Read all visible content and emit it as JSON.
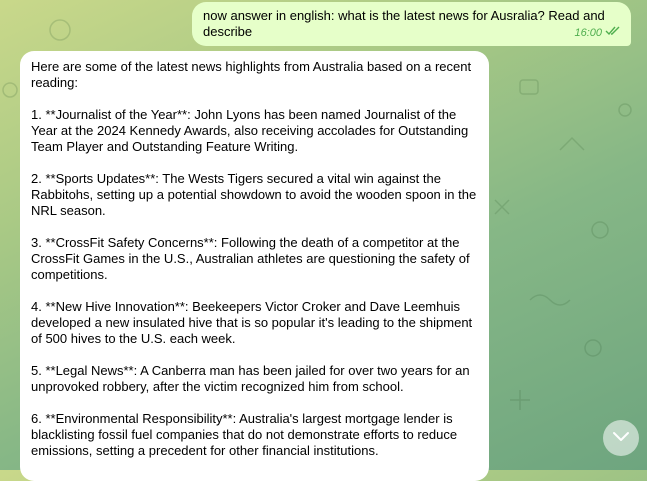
{
  "chat": {
    "outgoing": {
      "text": "now answer in english: what is the latest news for Ausralia? Read and describe",
      "time": "16:00",
      "status_icon": "double-check-icon"
    },
    "incoming": {
      "paragraphs": [
        "Here are some of the latest news highlights from Australia based on a recent reading:",
        "1. **Journalist of the Year**: John Lyons has been named Journalist of the Year at the 2024 Kennedy Awards, also receiving accolades for Outstanding Team Player and Outstanding Feature Writing.",
        "2. **Sports Updates**: The Wests Tigers secured a vital win against the Rabbitohs, setting up a potential showdown to avoid the wooden spoon in the NRL season.",
        "3. **CrossFit Safety Concerns**: Following the death of a competitor at the CrossFit Games in the U.S., Australian athletes are questioning the safety of competitions.",
        "4. **New Hive Innovation**: Beekeepers Victor Croker and Dave Leemhuis developed a new insulated hive that is so popular it's leading to the shipment of 500 hives to the U.S. each week.",
        "5. **Legal News**: A Canberra man has been jailed for over two years for an unprovoked robbery, after the victim recognized him from school.",
        "6. **Environmental Responsibility**: Australia's largest mortgage lender is blacklisting fossil fuel companies that do not demonstrate efforts to reduce emissions, setting a precedent for other financial institutions."
      ]
    }
  },
  "controls": {
    "scroll_down_icon": "chevron-down-icon"
  },
  "colors": {
    "outgoing_bubble": "#e6ffc9",
    "incoming_bubble": "#ffffff",
    "meta_green": "#4fae4e",
    "wallpaper_start": "#c9d88a",
    "wallpaper_end": "#6ea57f"
  }
}
